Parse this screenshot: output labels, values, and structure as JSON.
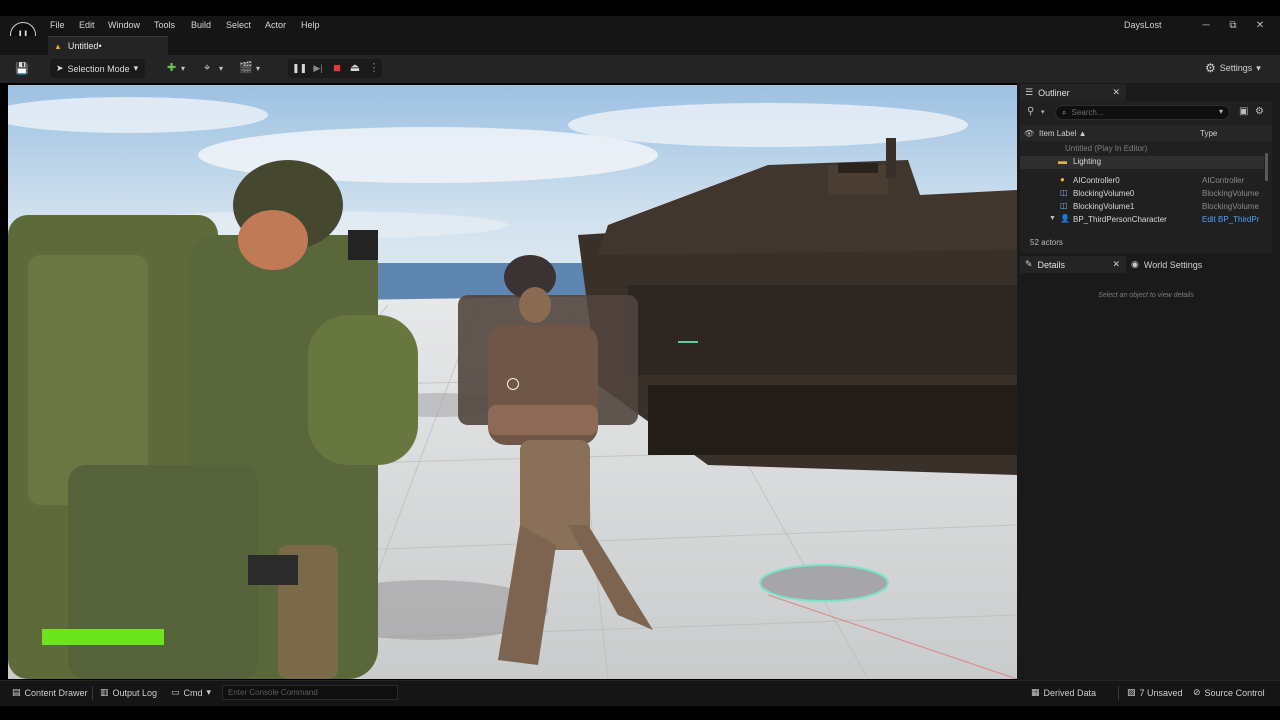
{
  "window": {
    "project": "DaysLost",
    "controls": {
      "minimize": "─",
      "maximize": "⧉",
      "close": "✕"
    }
  },
  "menu": [
    "File",
    "Edit",
    "Window",
    "Tools",
    "Build",
    "Select",
    "Actor",
    "Help"
  ],
  "tab": {
    "title": "Untitled•"
  },
  "toolbar": {
    "selection_mode": "Selection Mode",
    "settings": "Settings",
    "icons": {
      "save": "💾",
      "add": "✚",
      "snap": "⌖",
      "cinematics": "🎬",
      "pause": "❚❚",
      "skip": "▶|",
      "stop": "■",
      "eject": "⏏",
      "more": "⋮",
      "chevron": "▾",
      "gear": "⚙"
    }
  },
  "outliner": {
    "tab_label": "Outliner",
    "search_placeholder": "Search...",
    "col_label": "Item Label ▲",
    "col_type": "Type",
    "rows": [
      {
        "name": "Untitled (Play In Editor)",
        "type": ""
      },
      {
        "name": "Lighting",
        "type": ""
      },
      {
        "name": "AIController0",
        "type": "AIController"
      },
      {
        "name": "BlockingVolume0",
        "type": "BlockingVolume"
      },
      {
        "name": "BlockingVolume1",
        "type": "BlockingVolume"
      },
      {
        "name": "BP_ThirdPersonCharacter",
        "type": "Edit BP_ThirdPr"
      }
    ],
    "actor_count": "52 actors"
  },
  "details": {
    "tab_label": "Details",
    "world_settings": "World Settings",
    "hint": "Select an object to view details"
  },
  "statusbar": {
    "content_drawer": "Content Drawer",
    "output_log": "Output Log",
    "cmd": "Cmd",
    "console_placeholder": "Enter Console Command",
    "derived_data": "Derived Data",
    "unsaved": "7 Unsaved",
    "source_control": "Source Control"
  },
  "hud": {
    "health": 1.0
  },
  "colors": {
    "health": "#6be51e",
    "accent_link": "#4aa3ff",
    "folder": "#e0b043"
  }
}
